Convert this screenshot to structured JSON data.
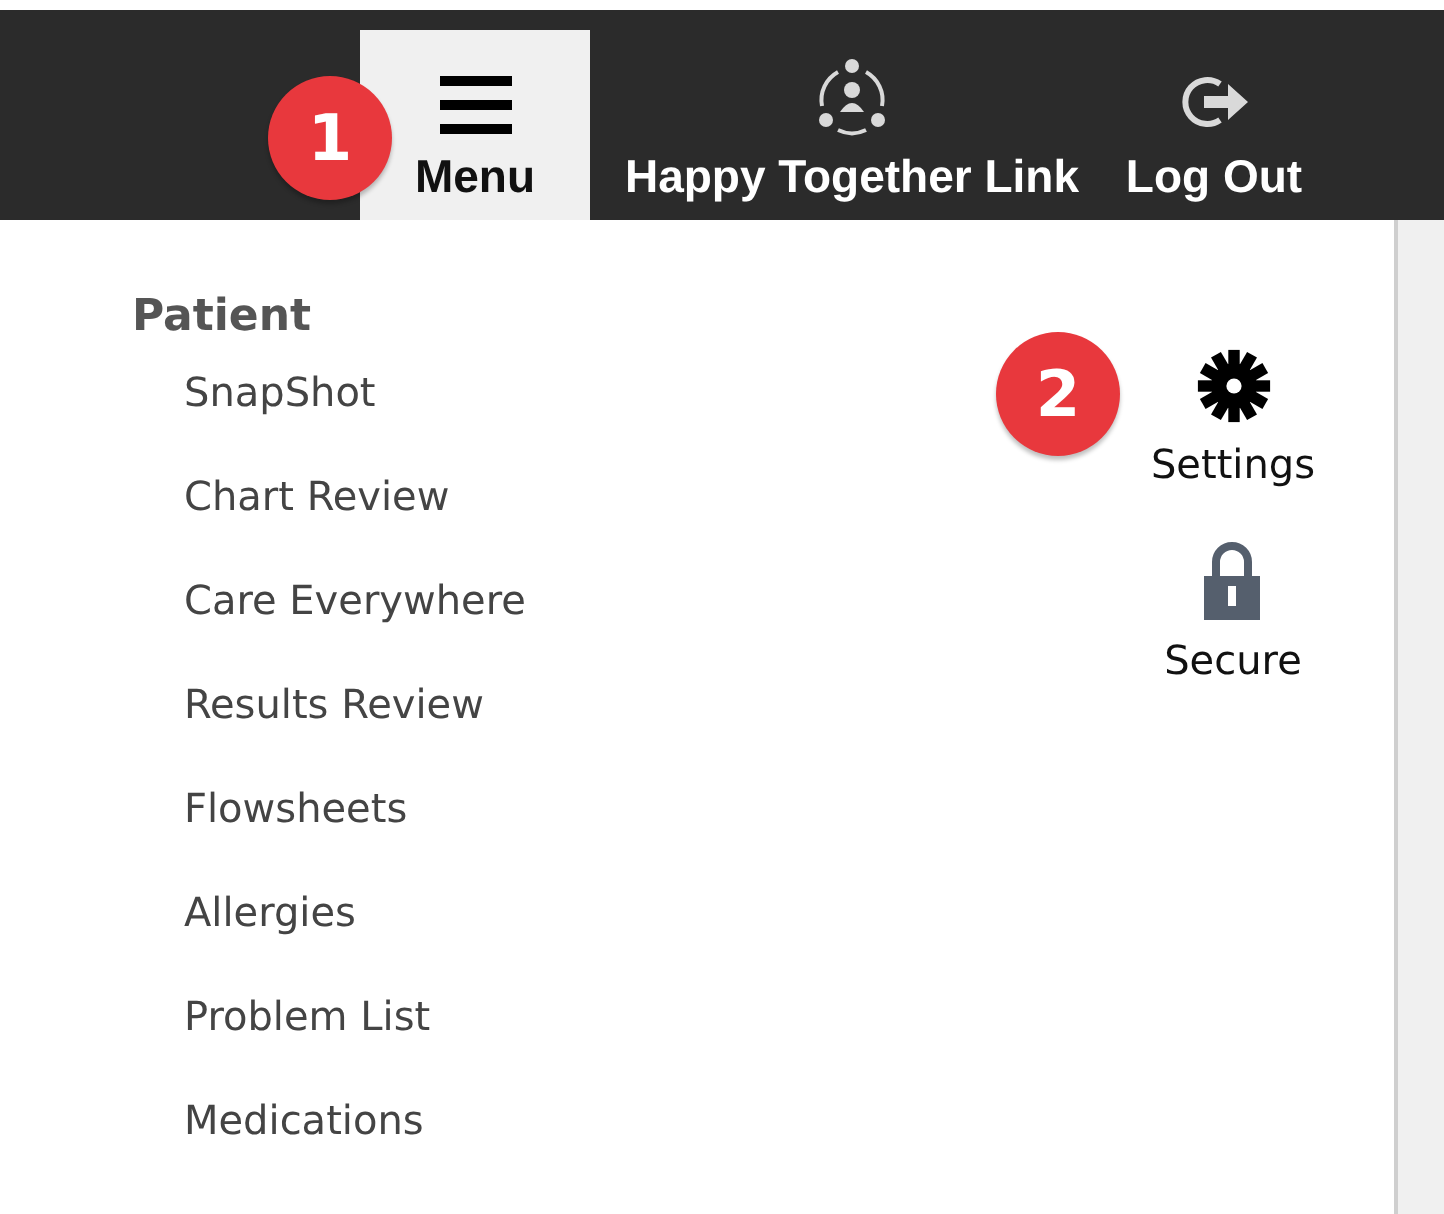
{
  "top_bar": {
    "items": [
      {
        "kind": "menu",
        "label": "Menu",
        "selected": true
      },
      {
        "kind": "link",
        "label": "Happy Together Link",
        "selected": false
      },
      {
        "kind": "logout",
        "label": "Log Out",
        "selected": false
      }
    ]
  },
  "menu": {
    "heading": "Patient",
    "items": [
      "SnapShot",
      "Chart Review",
      "Care Everywhere",
      "Results Review",
      "Flowsheets",
      "Allergies",
      "Problem List",
      "Medications"
    ]
  },
  "side_actions": [
    {
      "kind": "settings",
      "label": "Settings"
    },
    {
      "kind": "secure",
      "label": "Secure"
    }
  ],
  "callouts": [
    {
      "number": "1"
    },
    {
      "number": "2"
    }
  ]
}
